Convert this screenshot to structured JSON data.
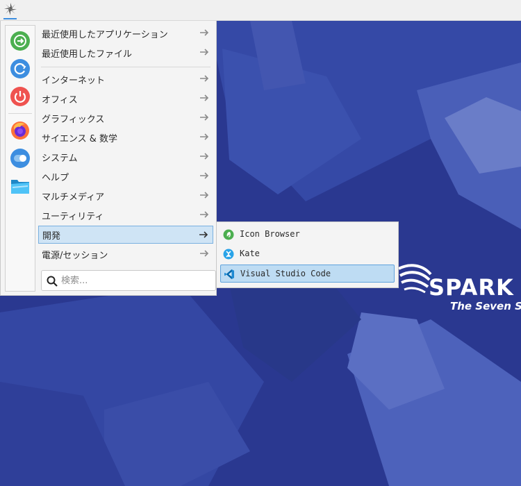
{
  "panel": {
    "launcher_icon": "sparky-launcher-icon"
  },
  "favorites": [
    {
      "name": "logout-icon",
      "color": "#4caf50"
    },
    {
      "name": "restart-icon",
      "color": "#3d8ee0"
    },
    {
      "name": "power-icon",
      "color": "#ef5350"
    },
    {
      "name": "firefox-icon",
      "color": "#ff7139"
    },
    {
      "name": "toggle-settings-icon",
      "color": "#3d8ee0"
    },
    {
      "name": "file-manager-icon",
      "color": "#29a3d8"
    }
  ],
  "categories": [
    {
      "label": "最近使用したアプリケーション"
    },
    {
      "label": "最近使用したファイル"
    },
    {
      "label": "インターネット"
    },
    {
      "label": "オフィス"
    },
    {
      "label": "グラフィックス"
    },
    {
      "label": "サイエンス & 数学"
    },
    {
      "label": "システム"
    },
    {
      "label": "ヘルプ"
    },
    {
      "label": "マルチメディア"
    },
    {
      "label": "ユーティリティ"
    },
    {
      "label": "開発",
      "active": true
    },
    {
      "label": "電源/セッション"
    }
  ],
  "search": {
    "placeholder": "検索..."
  },
  "submenu": {
    "items": [
      {
        "label": "Icon Browser"
      },
      {
        "label": "Kate"
      },
      {
        "label": "Visual Studio Code",
        "active": true
      }
    ]
  },
  "brand": {
    "word": "SPARK",
    "tagline": "The Seven Sis"
  },
  "colors": {
    "accent": "#3d8ee0",
    "highlight": "#cfe4f5",
    "desktop": "#2b3a93"
  }
}
